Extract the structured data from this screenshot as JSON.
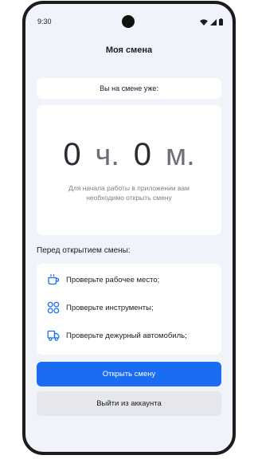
{
  "status_bar": {
    "time": "9:30"
  },
  "header": {
    "title": "Моя смена"
  },
  "shift": {
    "label": "Вы на смене уже:",
    "hours": "0",
    "hours_unit": "ч.",
    "minutes": "0",
    "minutes_unit": "м.",
    "hint": "Для начала работы в приложении вам необходимо открыть смену"
  },
  "checklist": {
    "title": "Перед открытием смены:",
    "items": [
      {
        "icon": "cup-icon",
        "label": "Проверьте рабочее место;"
      },
      {
        "icon": "tools-grid-icon",
        "label": "Проверьте инструменты;"
      },
      {
        "icon": "truck-icon",
        "label": "Проверьте дежурный автомобиль;"
      }
    ]
  },
  "actions": {
    "open_shift": "Открыть смену",
    "logout": "Выйти из аккаунта"
  },
  "colors": {
    "accent": "#1a6df2",
    "background": "#f1f3fb",
    "secondary_button": "#e6e7ec"
  }
}
